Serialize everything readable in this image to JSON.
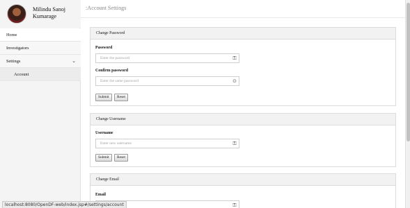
{
  "profile": {
    "name_line1": "Milindu Sanoj",
    "name_line2": "Kumarage"
  },
  "header": {
    "title": ":Account Settings"
  },
  "sidebar": {
    "items": [
      {
        "label": "Home"
      },
      {
        "label": "Investigators"
      },
      {
        "label": "Settings"
      },
      {
        "label": "Account"
      }
    ]
  },
  "password_panel": {
    "title": "Change Password",
    "password_label": "Password",
    "password_placeholder": "Enter the password",
    "confirm_label": "Confirm password",
    "confirm_placeholder": "Enter the same password",
    "submit_label": "Submit",
    "reset_label": "Reset"
  },
  "username_panel": {
    "title": "Change Username",
    "username_label": "Username",
    "username_placeholder": "Enter new username",
    "submit_label": "Submit",
    "reset_label": "Reset"
  },
  "email_panel": {
    "title": "Change Email",
    "email_label": "Email"
  },
  "status_bar": {
    "url": "localhost:8080/OpenDF-web/index.jsp#/settings/account"
  },
  "icons": {
    "field_key": "key-icon",
    "field_clear": "clear-icon",
    "chevron": "chevron-down-icon"
  }
}
